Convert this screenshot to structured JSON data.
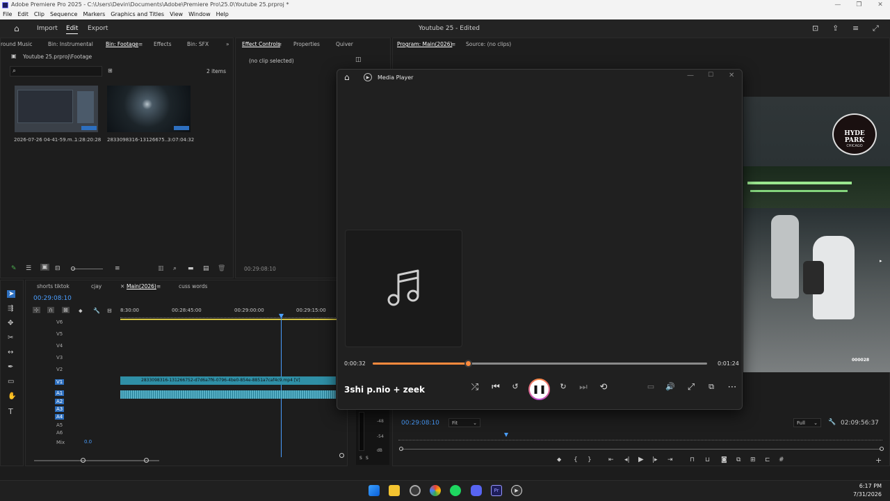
{
  "window_title": "Adobe Premiere Pro 2025 - C:\\Users\\Devin\\Documents\\Adobe\\Premiere Pro\\25.0\\Youtube 25.prproj *",
  "menu": [
    "File",
    "Edit",
    "Clip",
    "Sequence",
    "Markers",
    "Graphics and Titles",
    "View",
    "Window",
    "Help"
  ],
  "workspace": {
    "import": "Import",
    "edit": "Edit",
    "export": "Export",
    "project_title": "Youtube 25 - Edited"
  },
  "project_panel": {
    "tabs": [
      "round Music",
      "Bin: Instrumental",
      "Bin: Footage",
      "Effects",
      "Bin: SFX"
    ],
    "path": "Youtube 25.prproj\\Footage",
    "item_count": "2 items",
    "clips": [
      {
        "name": "2026-07-26 04-41-59.m...",
        "duration": "1:28:20:28"
      },
      {
        "name": "2833098316-13126675...",
        "duration": "3:07:04:32"
      }
    ]
  },
  "effect_controls": {
    "tabs": [
      "Effect Controls",
      "Properties",
      "Quiver"
    ],
    "no_clip": "(no clip selected)",
    "timecode": "00:29:08:10"
  },
  "program_monitor": {
    "tabs": [
      "Program: Main(2026)",
      "Source: (no clips)"
    ],
    "timecode": "00:29:08:10",
    "fit": "Fit",
    "quality": "Full",
    "duration": "02:09:56:37",
    "overlay_logo_line1": "HYDE PARK",
    "overlay_logo_line2": "CHICAGO",
    "overlay_counter": "000028"
  },
  "timeline": {
    "tabs": [
      "shorts tiktok",
      "cjay",
      "Main(2026)",
      "cuss words"
    ],
    "timecode": "00:29:08:10",
    "ruler": [
      "8:30:00",
      "00:28:45:00",
      "00:29:00:00",
      "00:29:15:00"
    ],
    "video_tracks": [
      "V6",
      "V5",
      "V4",
      "V3",
      "V2",
      "V1"
    ],
    "audio_tracks": [
      "A1",
      "A2",
      "A3",
      "A4",
      "A5",
      "A6"
    ],
    "mix_label": "Mix",
    "mix_value": "0.0",
    "clip_label": "2833098316-131266752-d7d6a7f6-0796-4be0-854e-8851a7caf4c9.mp4 [V]",
    "meter_labels": [
      "-48",
      "-54",
      "dB"
    ],
    "solo_labels": [
      "S",
      "S"
    ]
  },
  "media_player": {
    "app_title": "Media Player",
    "current_time": "0:00:32",
    "total_time": "0:01:24",
    "progress": 0.285,
    "track_title": "3shi p.nio + zeek",
    "accent": "#ff8a3d"
  },
  "taskbar": {
    "time": "6:17 PM",
    "date": "7/31/2026"
  }
}
